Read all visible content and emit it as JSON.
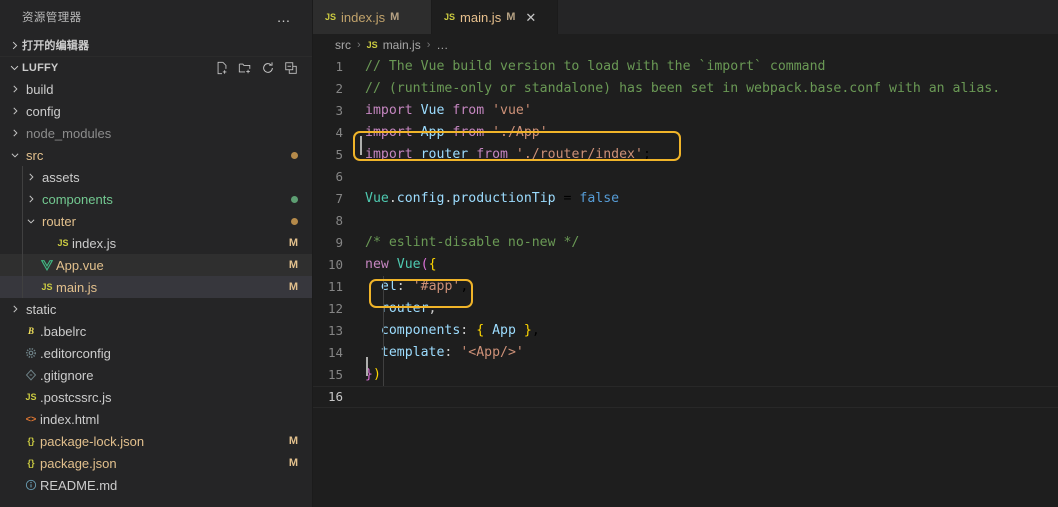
{
  "sidebar": {
    "header_title": "资源管理器",
    "more_actions": "…",
    "open_editors_label": "打开的编辑器",
    "project": {
      "name": "LUFFY",
      "actions": [
        "new-file",
        "new-folder",
        "refresh",
        "collapse-all"
      ]
    },
    "tree": [
      {
        "label": "build",
        "icon": "folder",
        "depth": 1,
        "expanded": false,
        "color": "default",
        "badge": "",
        "dot": ""
      },
      {
        "label": "config",
        "icon": "folder",
        "depth": 1,
        "expanded": false,
        "color": "default",
        "badge": "",
        "dot": ""
      },
      {
        "label": "node_modules",
        "icon": "folder",
        "depth": 1,
        "expanded": false,
        "color": "dim",
        "badge": "",
        "dot": ""
      },
      {
        "label": "src",
        "icon": "folder",
        "depth": 1,
        "expanded": true,
        "color": "mod",
        "badge": "",
        "dot": "mod"
      },
      {
        "label": "assets",
        "icon": "folder",
        "depth": 2,
        "expanded": false,
        "color": "default",
        "badge": "",
        "dot": ""
      },
      {
        "label": "components",
        "icon": "folder",
        "depth": 2,
        "expanded": false,
        "color": "add",
        "badge": "",
        "dot": "add"
      },
      {
        "label": "router",
        "icon": "folder",
        "depth": 2,
        "expanded": true,
        "color": "mod",
        "badge": "",
        "dot": "mod"
      },
      {
        "label": "index.js",
        "icon": "js",
        "depth": 3,
        "expanded": null,
        "color": "default",
        "badge": "M",
        "dot": ""
      },
      {
        "label": "App.vue",
        "icon": "vue",
        "depth": 2,
        "expanded": null,
        "color": "mod",
        "badge": "M",
        "dot": "",
        "state": "sel"
      },
      {
        "label": "main.js",
        "icon": "js",
        "depth": 2,
        "expanded": null,
        "color": "mod",
        "badge": "M",
        "dot": "",
        "state": "focus"
      },
      {
        "label": "static",
        "icon": "folder",
        "depth": 1,
        "expanded": false,
        "color": "default",
        "badge": "",
        "dot": ""
      },
      {
        "label": ".babelrc",
        "icon": "babel",
        "depth": 1,
        "expanded": null,
        "color": "default",
        "badge": "",
        "dot": ""
      },
      {
        "label": ".editorconfig",
        "icon": "gear",
        "depth": 1,
        "expanded": null,
        "color": "default",
        "badge": "",
        "dot": ""
      },
      {
        "label": ".gitignore",
        "icon": "git",
        "depth": 1,
        "expanded": null,
        "color": "default",
        "badge": "",
        "dot": ""
      },
      {
        "label": ".postcssrc.js",
        "icon": "js",
        "depth": 1,
        "expanded": null,
        "color": "default",
        "badge": "",
        "dot": ""
      },
      {
        "label": "index.html",
        "icon": "html",
        "depth": 1,
        "expanded": null,
        "color": "default",
        "badge": "",
        "dot": ""
      },
      {
        "label": "package-lock.json",
        "icon": "json",
        "depth": 1,
        "expanded": null,
        "color": "mod",
        "badge": "M",
        "dot": ""
      },
      {
        "label": "package.json",
        "icon": "json",
        "depth": 1,
        "expanded": null,
        "color": "mod",
        "badge": "M",
        "dot": ""
      },
      {
        "label": "README.md",
        "icon": "md",
        "depth": 1,
        "expanded": null,
        "color": "default",
        "badge": "",
        "dot": ""
      }
    ]
  },
  "tabs": [
    {
      "icon": "JS",
      "name": "index.js",
      "modified": "M",
      "active": false,
      "closable": false
    },
    {
      "icon": "JS",
      "name": "main.js",
      "modified": "M",
      "active": true,
      "closable": true,
      "close": "✕"
    }
  ],
  "breadcrumb": {
    "items": [
      {
        "label": "src",
        "icon": ""
      },
      {
        "label": "main.js",
        "icon": "JS"
      },
      {
        "label": "…",
        "icon": ""
      }
    ],
    "separator": "›"
  },
  "editor": {
    "filename": "main.js",
    "cursor_line": 16,
    "total_lines": 16,
    "line_numbers": [
      "1",
      "2",
      "3",
      "4",
      "5",
      "6",
      "7",
      "8",
      "9",
      "10",
      "11",
      "12",
      "13",
      "14",
      "15",
      "16"
    ],
    "lines": [
      "// The Vue build version to load with the `import` command",
      "// (runtime-only or standalone) has been set in webpack.base.conf with an alias.",
      "import Vue from 'vue'",
      "import App from './App'",
      "import router from './router/index';",
      "",
      "Vue.config.productionTip = false",
      "",
      "/* eslint-disable no-new */",
      "new Vue({",
      "  el: '#app',",
      "  router,",
      "  components: { App },",
      "  template: '<App/>'",
      "})",
      ""
    ],
    "highlights": [
      {
        "name": "import-router-highlight",
        "line": 5,
        "color": "#f0b429"
      },
      {
        "name": "router-option-highlight",
        "line": 12,
        "color": "#f0b429"
      }
    ]
  },
  "colors": {
    "sidebar_bg": "#252526",
    "editor_bg": "#1e1e1e",
    "tab_inactive_bg": "#2d2d2d",
    "accent_highlight": "#f0b429",
    "modified_badge": "#e2c08d",
    "added": "#73c991"
  }
}
